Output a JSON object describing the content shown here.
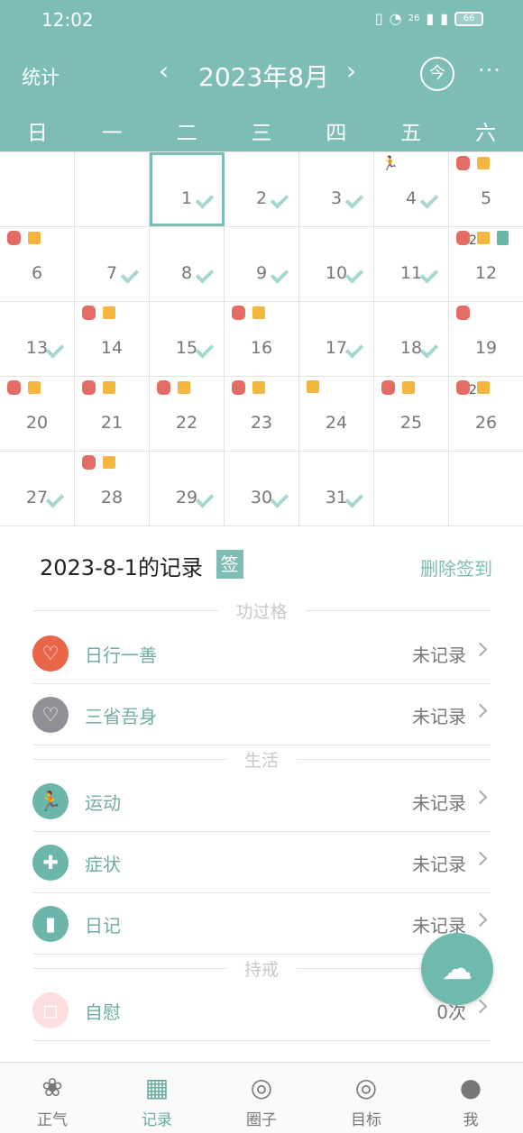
{
  "status_bar": {
    "time": "12:02",
    "network": "26",
    "battery": "66"
  },
  "header": {
    "stats": "统计",
    "month": "2023年8月",
    "today": "今",
    "more": "···"
  },
  "weekdays": [
    "日",
    "一",
    "二",
    "三",
    "四",
    "五",
    "六"
  ],
  "calendar": {
    "rows": [
      [
        {
          "day": "",
          "checked": false
        },
        {
          "day": "",
          "checked": false
        },
        {
          "day": "1",
          "checked": true,
          "selected": true
        },
        {
          "day": "2",
          "checked": true
        },
        {
          "day": "3",
          "checked": true
        },
        {
          "day": "4",
          "checked": true,
          "badges": [
            "runner-icon"
          ]
        },
        {
          "day": "5",
          "checked": false,
          "badges": [
            "red-tag-icon",
            "yellow-tag-icon"
          ]
        }
      ],
      [
        {
          "day": "6",
          "checked": false,
          "badges": [
            "red-tag-icon",
            "yellow-tag-icon"
          ]
        },
        {
          "day": "7",
          "checked": true
        },
        {
          "day": "8",
          "checked": true
        },
        {
          "day": "9",
          "checked": true
        },
        {
          "day": "10",
          "checked": true
        },
        {
          "day": "11",
          "checked": true
        },
        {
          "day": "12",
          "checked": false,
          "badges": [
            "red-tag-icon",
            "yellow-tag-icon",
            "diary-icon"
          ],
          "count": "2"
        }
      ],
      [
        {
          "day": "13",
          "checked": true
        },
        {
          "day": "14",
          "checked": false,
          "badges": [
            "red-tag-icon",
            "yellow-tag-icon"
          ]
        },
        {
          "day": "15",
          "checked": true
        },
        {
          "day": "16",
          "checked": false,
          "badges": [
            "red-tag-icon",
            "yellow-tag-icon"
          ]
        },
        {
          "day": "17",
          "checked": true
        },
        {
          "day": "18",
          "checked": true
        },
        {
          "day": "19",
          "checked": false,
          "badges": [
            "red-tag-icon"
          ]
        }
      ],
      [
        {
          "day": "20",
          "checked": false,
          "badges": [
            "red-tag-icon",
            "yellow-tag-icon"
          ]
        },
        {
          "day": "21",
          "checked": false,
          "badges": [
            "red-tag-icon",
            "yellow-tag-icon"
          ]
        },
        {
          "day": "22",
          "checked": false,
          "badges": [
            "red-tag-icon",
            "yellow-tag-icon"
          ]
        },
        {
          "day": "23",
          "checked": false,
          "badges": [
            "red-tag-icon",
            "yellow-tag-icon"
          ]
        },
        {
          "day": "24",
          "checked": false,
          "badges": [
            "yellow-tag-icon"
          ]
        },
        {
          "day": "25",
          "checked": false,
          "badges": [
            "red-tag-icon",
            "yellow-tag-icon"
          ]
        },
        {
          "day": "26",
          "checked": false,
          "badges": [
            "red-tag-icon",
            "yellow-tag-icon"
          ],
          "count": "2"
        }
      ],
      [
        {
          "day": "27",
          "checked": true
        },
        {
          "day": "28",
          "checked": false,
          "badges": [
            "red-tag-icon",
            "yellow-tag-icon"
          ]
        },
        {
          "day": "29",
          "checked": true
        },
        {
          "day": "30",
          "checked": true
        },
        {
          "day": "31",
          "checked": true
        },
        {
          "day": "",
          "checked": false
        },
        {
          "day": "",
          "checked": false
        }
      ]
    ]
  },
  "record": {
    "title": "2023-8-1的记录",
    "sign_tag": "签",
    "delete_label": "删除签到",
    "sections": {
      "merit": "功过格",
      "life": "生活",
      "precepts": "持戒"
    },
    "items": [
      {
        "label": "日行一善",
        "value": "未记录",
        "icon_name": "heart-icon",
        "color": "#e86547"
      },
      {
        "label": "三省吾身",
        "value": "未记录",
        "icon_name": "reflection-heart-icon",
        "color": "#908f96"
      },
      {
        "label": "运动",
        "value": "未记录",
        "icon_name": "running-icon",
        "color": "#6bb5aa"
      },
      {
        "label": "症状",
        "value": "未记录",
        "icon_name": "medical-kit-icon",
        "color": "#6bb5aa"
      },
      {
        "label": "日记",
        "value": "未记录",
        "icon_name": "notebook-icon",
        "color": "#6bb5aa"
      },
      {
        "label": "自慰",
        "value": "0次",
        "icon_name": "cup-icon",
        "color": "#fbdedd"
      }
    ]
  },
  "tabs": [
    {
      "label": "正气",
      "icon_name": "lotus-icon"
    },
    {
      "label": "记录",
      "icon_name": "calendar-icon",
      "active": true
    },
    {
      "label": "圈子",
      "icon_name": "circle-icon"
    },
    {
      "label": "目标",
      "icon_name": "target-icon"
    },
    {
      "label": "我",
      "icon_name": "profile-icon"
    }
  ],
  "theme": {
    "primary": "#7dbdb5",
    "accent_red": "#e36c65",
    "accent_yellow": "#f3b63e"
  }
}
